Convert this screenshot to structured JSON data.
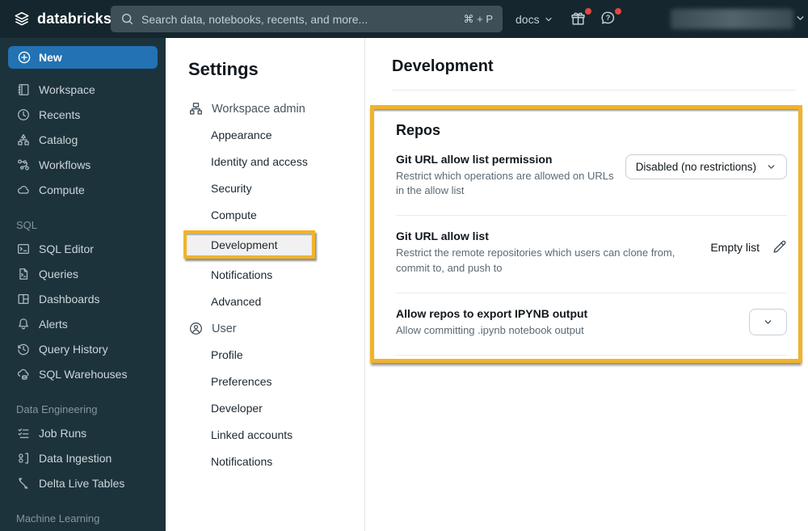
{
  "topbar": {
    "logo": "databricks",
    "search_placeholder": "Search data, notebooks, recents, and more...",
    "search_shortcut": "⌘ + P",
    "docs": "docs"
  },
  "sidebar": {
    "new": "New",
    "items": [
      "Workspace",
      "Recents",
      "Catalog",
      "Workflows",
      "Compute"
    ],
    "sql_header": "SQL",
    "sql_items": [
      "SQL Editor",
      "Queries",
      "Dashboards",
      "Alerts",
      "Query History",
      "SQL Warehouses"
    ],
    "de_header": "Data Engineering",
    "de_items": [
      "Job Runs",
      "Data Ingestion",
      "Delta Live Tables"
    ],
    "ml_header": "Machine Learning"
  },
  "settings": {
    "title": "Settings",
    "admin_group": "Workspace admin",
    "admin_items": [
      "Appearance",
      "Identity and access",
      "Security",
      "Compute",
      "Development",
      "Notifications",
      "Advanced"
    ],
    "selected_item": "Development",
    "user_group": "User",
    "user_items": [
      "Profile",
      "Preferences",
      "Developer",
      "Linked accounts",
      "Notifications"
    ]
  },
  "main": {
    "title": "Development",
    "repos": {
      "title": "Repos",
      "rows": [
        {
          "label": "Git URL allow list permission",
          "desc": "Restrict which operations are allowed on URLs in the allow list",
          "value": "Disabled (no restrictions)"
        },
        {
          "label": "Git URL allow list",
          "desc": "Restrict the remote repositories which users can clone from, commit to, and push to",
          "value": "Empty list"
        },
        {
          "label": "Allow repos to export IPYNB output",
          "desc": "Allow committing .ipynb notebook output",
          "value": ""
        }
      ]
    }
  },
  "colors": {
    "topbar": "#15262E",
    "sidebar": "#1D333C",
    "accent_blue": "#2272B4",
    "annotation_yellow": "#F0B429",
    "notification_red": "#E8453C"
  }
}
